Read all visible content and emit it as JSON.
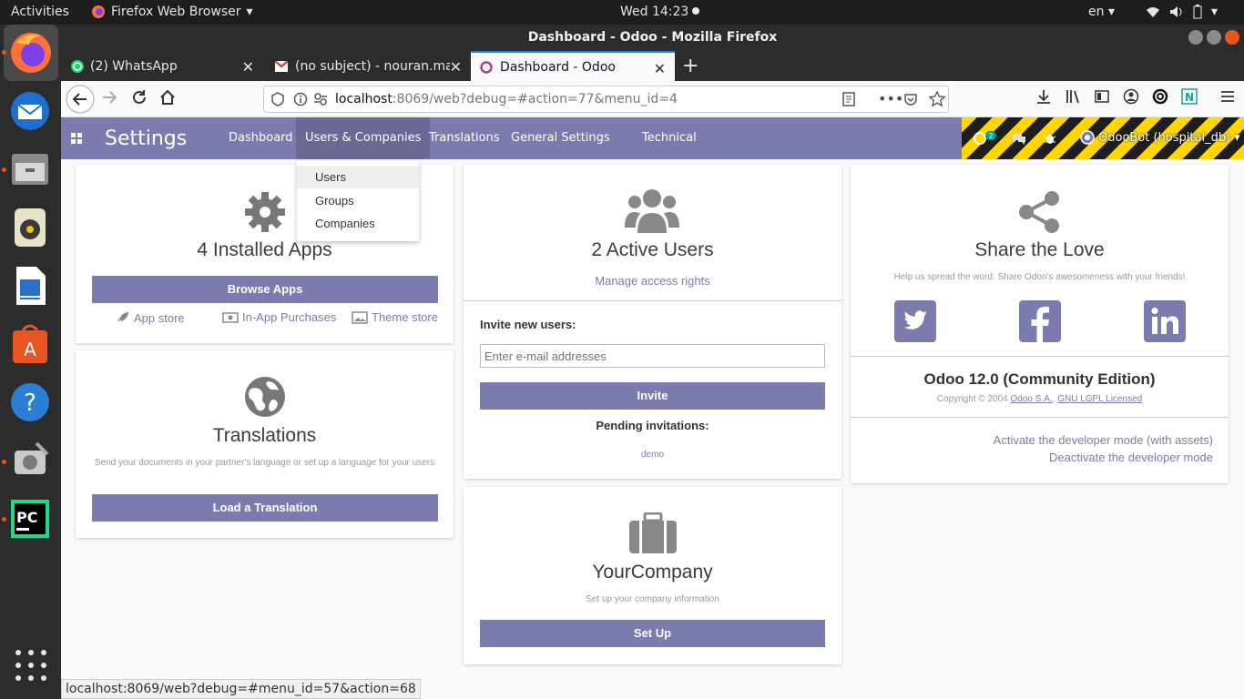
{
  "topbar": {
    "activities": "Activities",
    "app_name": "Firefox Web Browser",
    "clock": "Wed 14:23",
    "lang": "en"
  },
  "window": {
    "title": "Dashboard - Odoo - Mozilla Firefox"
  },
  "tabs": [
    {
      "label": "(2) WhatsApp"
    },
    {
      "label": "(no subject) - nouran.ma"
    },
    {
      "label": "Dashboard - Odoo"
    }
  ],
  "nav": {
    "url_host": "localhost",
    "url_rest": ":8069/web?debug=#action=77&menu_id=4"
  },
  "odoo": {
    "brand": "Settings",
    "menu": [
      "Dashboard",
      "Users & Companies",
      "Translations",
      "General Settings",
      "Technical"
    ],
    "user": "OdooBot (hospital_db)",
    "notif_count": "2",
    "dropdown": [
      "Users",
      "Groups",
      "Companies"
    ]
  },
  "apps": {
    "title": "4 Installed Apps",
    "button": "Browse Apps",
    "links": [
      "App store",
      "In-App Purchases",
      "Theme store"
    ]
  },
  "translations": {
    "title": "Translations",
    "desc": "Send your documents in your partner's language or set up a language for your users",
    "button": "Load a Translation"
  },
  "users": {
    "title": "2 Active Users",
    "manage": "Manage access rights",
    "invite_label": "Invite new users:",
    "invite_placeholder": "Enter e-mail addresses",
    "invite_button": "Invite",
    "pending_label": "Pending invitations:",
    "pending": "demo"
  },
  "company": {
    "title": "YourCompany",
    "desc": "Set up your company information",
    "button": "Set Up"
  },
  "share": {
    "title": "Share the Love",
    "desc": "Help us spread the word: Share Odoo's awesomeness with your friends!",
    "version": "Odoo 12.0 (Community Edition)",
    "copyright": "Copyright © 2004",
    "odoo_sa": "Odoo S.A.",
    "license": "GNU LGPL Licensed",
    "dev_assets": "Activate the developer mode (with assets)",
    "dev_off": "Deactivate the developer mode"
  },
  "statusbar": "localhost:8069/web?debug=#menu_id=57&action=68",
  "colors": {
    "odoo_primary": "#7c7bad",
    "ubuntu_bar": "#1d1d1d",
    "dock": "#2c2c2c"
  }
}
